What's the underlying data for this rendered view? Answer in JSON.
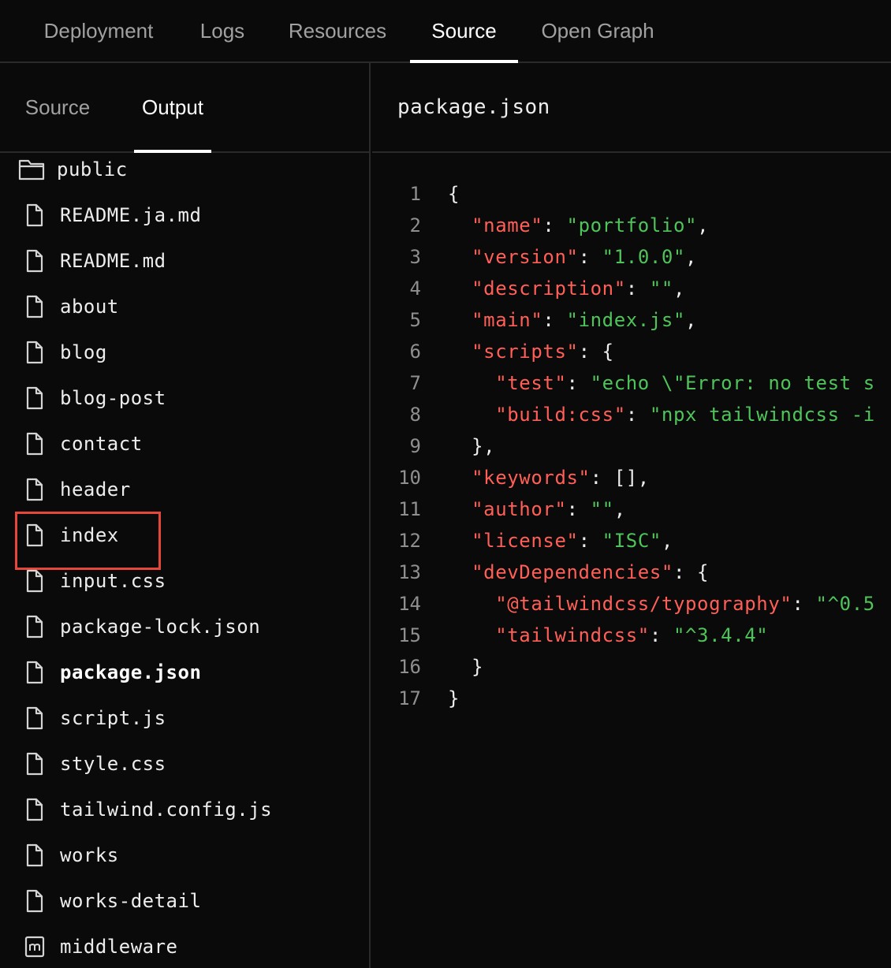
{
  "top_tabs": [
    {
      "label": "Deployment",
      "active": false
    },
    {
      "label": "Logs",
      "active": false
    },
    {
      "label": "Resources",
      "active": false
    },
    {
      "label": "Source",
      "active": true
    },
    {
      "label": "Open Graph",
      "active": false
    }
  ],
  "sidebar": {
    "tabs": [
      {
        "label": "Source",
        "active": false
      },
      {
        "label": "Output",
        "active": true
      }
    ],
    "files": [
      {
        "name": "public",
        "type": "folder",
        "icon": "folder-icon"
      },
      {
        "name": "README.ja.md",
        "type": "file",
        "icon": "file-icon"
      },
      {
        "name": "README.md",
        "type": "file",
        "icon": "file-icon"
      },
      {
        "name": "about",
        "type": "file",
        "icon": "file-icon"
      },
      {
        "name": "blog",
        "type": "file",
        "icon": "file-icon"
      },
      {
        "name": "blog-post",
        "type": "file",
        "icon": "file-icon"
      },
      {
        "name": "contact",
        "type": "file",
        "icon": "file-icon"
      },
      {
        "name": "header",
        "type": "file",
        "icon": "file-icon"
      },
      {
        "name": "index",
        "type": "file",
        "icon": "file-icon",
        "highlighted": true
      },
      {
        "name": "input.css",
        "type": "file",
        "icon": "file-icon"
      },
      {
        "name": "package-lock.json",
        "type": "file",
        "icon": "file-icon"
      },
      {
        "name": "package.json",
        "type": "file",
        "icon": "file-icon",
        "selected": true
      },
      {
        "name": "script.js",
        "type": "file",
        "icon": "file-icon"
      },
      {
        "name": "style.css",
        "type": "file",
        "icon": "file-icon"
      },
      {
        "name": "tailwind.config.js",
        "type": "file",
        "icon": "file-icon"
      },
      {
        "name": "works",
        "type": "file",
        "icon": "file-icon"
      },
      {
        "name": "works-detail",
        "type": "file",
        "icon": "file-icon"
      },
      {
        "name": "middleware",
        "type": "middleware",
        "icon": "middleware-icon"
      }
    ]
  },
  "editor": {
    "filename": "package.json",
    "lines": [
      {
        "n": "1",
        "tokens": [
          [
            "pun",
            "{"
          ]
        ]
      },
      {
        "n": "2",
        "tokens": [
          [
            "pun",
            "  "
          ],
          [
            "key",
            "\"name\""
          ],
          [
            "pun",
            ": "
          ],
          [
            "str",
            "\"portfolio\""
          ],
          [
            "pun",
            ","
          ]
        ]
      },
      {
        "n": "3",
        "tokens": [
          [
            "pun",
            "  "
          ],
          [
            "key",
            "\"version\""
          ],
          [
            "pun",
            ": "
          ],
          [
            "str",
            "\"1.0.0\""
          ],
          [
            "pun",
            ","
          ]
        ]
      },
      {
        "n": "4",
        "tokens": [
          [
            "pun",
            "  "
          ],
          [
            "key",
            "\"description\""
          ],
          [
            "pun",
            ": "
          ],
          [
            "str",
            "\"\""
          ],
          [
            "pun",
            ","
          ]
        ]
      },
      {
        "n": "5",
        "tokens": [
          [
            "pun",
            "  "
          ],
          [
            "key",
            "\"main\""
          ],
          [
            "pun",
            ": "
          ],
          [
            "str",
            "\"index.js\""
          ],
          [
            "pun",
            ","
          ]
        ]
      },
      {
        "n": "6",
        "tokens": [
          [
            "pun",
            "  "
          ],
          [
            "key",
            "\"scripts\""
          ],
          [
            "pun",
            ": {"
          ]
        ]
      },
      {
        "n": "7",
        "tokens": [
          [
            "pun",
            "    "
          ],
          [
            "key",
            "\"test\""
          ],
          [
            "pun",
            ": "
          ],
          [
            "str",
            "\"echo \\\"Error: no test s"
          ]
        ]
      },
      {
        "n": "8",
        "tokens": [
          [
            "pun",
            "    "
          ],
          [
            "key",
            "\"build:css\""
          ],
          [
            "pun",
            ": "
          ],
          [
            "str",
            "\"npx tailwindcss -i"
          ]
        ]
      },
      {
        "n": "9",
        "tokens": [
          [
            "pun",
            "  },"
          ]
        ]
      },
      {
        "n": "10",
        "tokens": [
          [
            "pun",
            "  "
          ],
          [
            "key",
            "\"keywords\""
          ],
          [
            "pun",
            ": [],"
          ]
        ]
      },
      {
        "n": "11",
        "tokens": [
          [
            "pun",
            "  "
          ],
          [
            "key",
            "\"author\""
          ],
          [
            "pun",
            ": "
          ],
          [
            "str",
            "\"\""
          ],
          [
            "pun",
            ","
          ]
        ]
      },
      {
        "n": "12",
        "tokens": [
          [
            "pun",
            "  "
          ],
          [
            "key",
            "\"license\""
          ],
          [
            "pun",
            ": "
          ],
          [
            "str",
            "\"ISC\""
          ],
          [
            "pun",
            ","
          ]
        ]
      },
      {
        "n": "13",
        "tokens": [
          [
            "pun",
            "  "
          ],
          [
            "key",
            "\"devDependencies\""
          ],
          [
            "pun",
            ": {"
          ]
        ]
      },
      {
        "n": "14",
        "tokens": [
          [
            "pun",
            "    "
          ],
          [
            "key",
            "\"@tailwindcss/typography\""
          ],
          [
            "pun",
            ": "
          ],
          [
            "str",
            "\"^0.5"
          ]
        ]
      },
      {
        "n": "15",
        "tokens": [
          [
            "pun",
            "    "
          ],
          [
            "key",
            "\"tailwindcss\""
          ],
          [
            "pun",
            ": "
          ],
          [
            "str",
            "\"^3.4.4\""
          ]
        ]
      },
      {
        "n": "16",
        "tokens": [
          [
            "pun",
            "  }"
          ]
        ]
      },
      {
        "n": "17",
        "tokens": [
          [
            "pun",
            "}"
          ]
        ]
      }
    ]
  },
  "colors": {
    "background": "#0a0a0a",
    "border": "#2a2a2a",
    "json_key": "#ff5f57",
    "json_string": "#4ec45a",
    "highlight_box": "#e5483a"
  }
}
